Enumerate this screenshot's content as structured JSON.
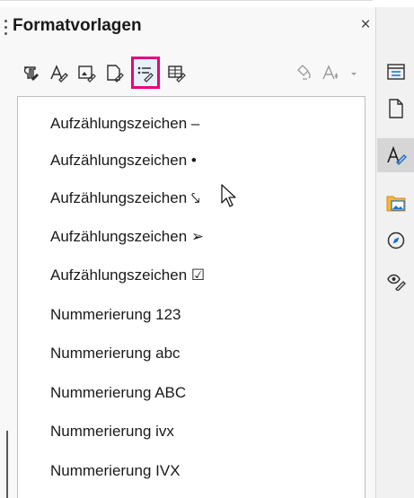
{
  "panel": {
    "title": "Formatvorlagen",
    "close_label": "×"
  },
  "toolbar": {
    "buttons": [
      {
        "icon": "paragraph-styles-icon"
      },
      {
        "icon": "character-styles-icon"
      },
      {
        "icon": "frame-styles-icon"
      },
      {
        "icon": "page-styles-icon"
      },
      {
        "icon": "list-styles-icon",
        "selected": true
      },
      {
        "icon": "table-styles-icon"
      }
    ],
    "right_buttons": [
      {
        "icon": "fill-format-mode-icon"
      },
      {
        "icon": "new-style-from-selection-icon"
      }
    ],
    "selection_color": "#e6007e"
  },
  "styles_list": {
    "items": [
      "Aufzählungszeichen –",
      "Aufzählungszeichen •",
      "Aufzählungszeichen ⤥",
      "Aufzählungszeichen ➢",
      "Aufzählungszeichen ☑",
      "Nummerierung 123",
      "Nummerierung abc",
      "Nummerierung ABC",
      "Nummerierung ivx",
      "Nummerierung IVX"
    ]
  },
  "sidebar": {
    "buttons": [
      {
        "icon": "sidebar-menu-icon"
      },
      {
        "icon": "properties-icon"
      },
      {
        "icon": "styles-icon",
        "active": true
      },
      {
        "icon": "gallery-icon"
      },
      {
        "icon": "navigator-icon"
      },
      {
        "icon": "style-inspector-icon"
      }
    ]
  }
}
